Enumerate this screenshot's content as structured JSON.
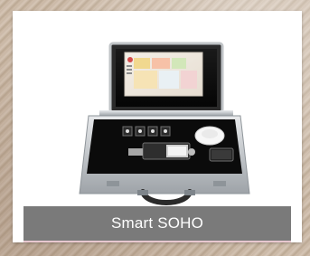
{
  "card": {
    "caption": "Smart SOHO"
  },
  "photo": {
    "subject_icon": "briefcase-demo-kit-icon"
  },
  "colors": {
    "caption_bar": "#7a7a7a",
    "case_frame": "#bfc3c6",
    "case_inner": "#111111",
    "accent_line": "#e7c7cf"
  }
}
